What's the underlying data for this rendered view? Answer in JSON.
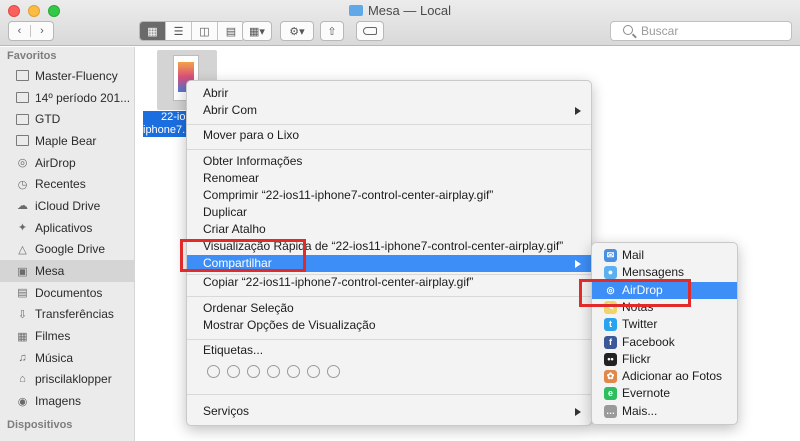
{
  "window": {
    "title": "Mesa — Local"
  },
  "toolbar": {
    "search_placeholder": "Buscar"
  },
  "sidebar": {
    "favorites_header": "Favoritos",
    "devices_header": "Dispositivos",
    "items": [
      {
        "label": "Master-Fluency",
        "icon": "folder-icon"
      },
      {
        "label": "14º período 201...",
        "icon": "folder-icon"
      },
      {
        "label": "GTD",
        "icon": "folder-icon"
      },
      {
        "label": "Maple Bear",
        "icon": "folder-icon"
      },
      {
        "label": "AirDrop",
        "icon": "airdrop-icon"
      },
      {
        "label": "Recentes",
        "icon": "clock-icon"
      },
      {
        "label": "iCloud Drive",
        "icon": "cloud-icon"
      },
      {
        "label": "Aplicativos",
        "icon": "apps-icon"
      },
      {
        "label": "Google Drive",
        "icon": "google-drive-icon"
      },
      {
        "label": "Mesa",
        "icon": "desktop-icon",
        "selected": true
      },
      {
        "label": "Documentos",
        "icon": "document-icon"
      },
      {
        "label": "Transferências",
        "icon": "download-icon"
      },
      {
        "label": "Filmes",
        "icon": "film-icon"
      },
      {
        "label": "Música",
        "icon": "music-icon"
      },
      {
        "label": "priscilaklopper",
        "icon": "home-icon"
      },
      {
        "label": "Imagens",
        "icon": "camera-icon"
      }
    ]
  },
  "file": {
    "name_line1": "22-ios",
    "name_line2": "iphone7..."
  },
  "context_menu": {
    "items": {
      "abrir": "Abrir",
      "abrir_com": "Abrir Com",
      "mover_lixo": "Mover para o Lixo",
      "obter_info": "Obter Informações",
      "renomear": "Renomear",
      "comprimir": "Comprimir “22-ios11-iphone7-control-center-airplay.gif”",
      "duplicar": "Duplicar",
      "criar_atalho": "Criar Atalho",
      "visualizacao": "Visualização Rápida de “22-ios11-iphone7-control-center-airplay.gif”",
      "compartilhar": "Compartilhar",
      "copiar": "Copiar “22-ios11-iphone7-control-center-airplay.gif”",
      "ordenar": "Ordenar Seleção",
      "mostrar_opcoes": "Mostrar Opções de Visualização",
      "etiquetas": "Etiquetas...",
      "servicos": "Serviços"
    }
  },
  "share_submenu": {
    "items": [
      {
        "label": "Mail",
        "icon": "mail-icon",
        "color": "#4a8fe0"
      },
      {
        "label": "Mensagens",
        "icon": "messages-icon",
        "color": "#5ab0f0"
      },
      {
        "label": "AirDrop",
        "icon": "airdrop-icon",
        "color": "#3d8ef7"
      },
      {
        "label": "Notas",
        "icon": "notes-icon",
        "color": "#f0d46a"
      },
      {
        "label": "Twitter",
        "icon": "twitter-icon",
        "color": "#2aa3ef"
      },
      {
        "label": "Facebook",
        "icon": "facebook-icon",
        "color": "#3b5998"
      },
      {
        "label": "Flickr",
        "icon": "flickr-icon",
        "color": "#222222"
      },
      {
        "label": "Adicionar ao Fotos",
        "icon": "photos-icon",
        "color": "#e0884a"
      },
      {
        "label": "Evernote",
        "icon": "evernote-icon",
        "color": "#2dbe60"
      },
      {
        "label": "Mais...",
        "icon": "more-icon",
        "color": "#9a9a9a"
      }
    ]
  },
  "colors": {
    "highlight": "#3d8ef7",
    "annotation_red": "#e12a2a",
    "selection_blue": "#1a6ee0"
  }
}
